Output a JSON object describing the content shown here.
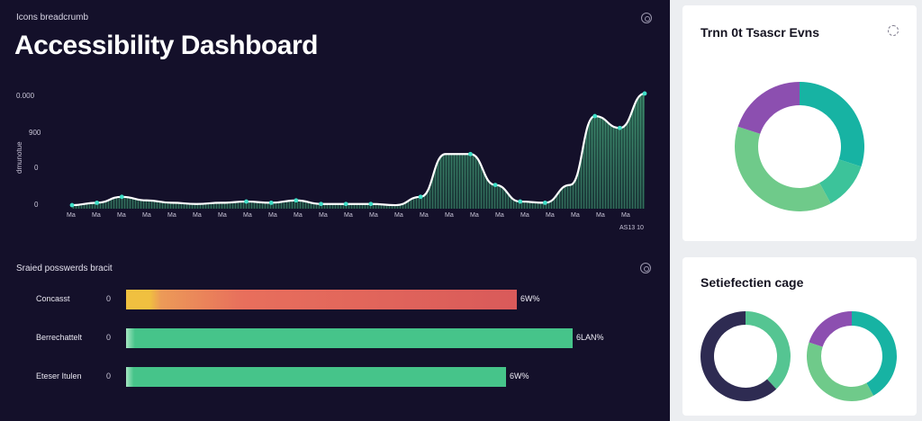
{
  "main": {
    "eyebrow": "Icons breadcrumb",
    "title": "Accessibility Dashboard"
  },
  "chart_data": {
    "type": "area",
    "ylabel": "dmunotue",
    "y_ticks": [
      "0.000",
      "900",
      "0",
      "0"
    ],
    "x_ticks": [
      "Ma",
      "Ma",
      "Ma",
      "Ma",
      "Ma",
      "Ma",
      "Ma",
      "Ma",
      "Ma",
      "Ma",
      "Ma",
      "Ma",
      "Ma",
      "Ma",
      "Ma",
      "Ma",
      "Ma",
      "Ma",
      "Ma",
      "Ma",
      "Ma",
      "Ma",
      "Ma"
    ],
    "x_caption": "AS13 10",
    "ylim": [
      0,
      100
    ],
    "values": [
      3,
      5,
      10,
      7,
      5,
      4,
      5,
      6,
      5,
      7,
      4,
      4,
      4,
      3,
      10,
      46,
      46,
      20,
      6,
      5,
      20,
      78,
      68,
      97
    ],
    "markers": [
      0,
      1,
      2,
      7,
      8,
      9,
      10,
      11,
      12,
      14,
      16,
      17,
      18,
      19,
      21,
      22,
      23
    ]
  },
  "bars": {
    "title": "Sraied posswerds bracit",
    "rows": [
      {
        "label": "Concasst",
        "zero": "0",
        "value_label": "6W%",
        "value": 0.7,
        "color": "#d95a5a",
        "lead": "#f0c040"
      },
      {
        "label": "Berrechattelt",
        "zero": "0",
        "value_label": "6LAN%",
        "value": 0.8,
        "color": "#46c48a",
        "lead": "#46c48a"
      },
      {
        "label": "Eteser Itulen",
        "zero": "0",
        "value_label": "6W%",
        "value": 0.68,
        "color": "#46c48a",
        "lead": "#46c48a"
      }
    ]
  },
  "donut_card": {
    "title": "Trnn 0t Tsascr Evns",
    "slices": [
      {
        "value": 0.3,
        "color": "#17b3a3"
      },
      {
        "value": 0.12,
        "color": "#3cc39a"
      },
      {
        "value": 0.38,
        "color": "#6fca8a"
      },
      {
        "value": 0.2,
        "color": "#8c4fb0"
      }
    ]
  },
  "satisfaction_card": {
    "title": "Setiefectien cage",
    "donut_a": [
      {
        "value": 0.38,
        "color": "#55c592"
      },
      {
        "value": 0.62,
        "color": "#2e2b52"
      }
    ],
    "donut_b": [
      {
        "value": 0.42,
        "color": "#17b3a3"
      },
      {
        "value": 0.38,
        "color": "#6fca8a"
      },
      {
        "value": 0.2,
        "color": "#8c4fb0"
      }
    ]
  }
}
